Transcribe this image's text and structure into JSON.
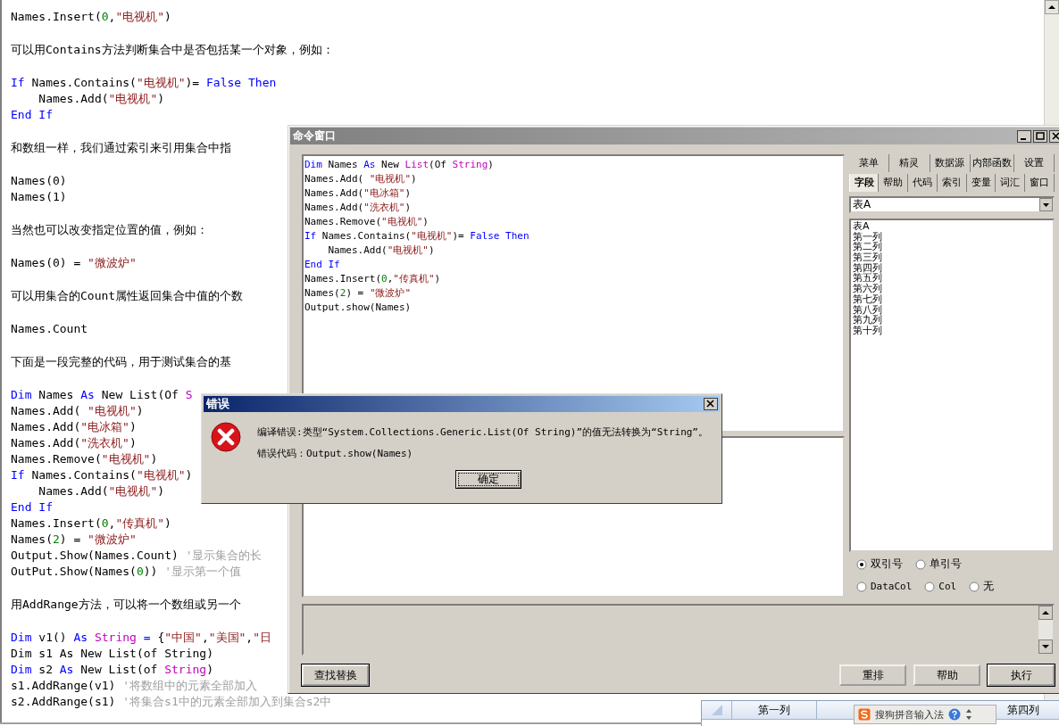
{
  "document": {
    "paragraphs": [
      {
        "lines": [
          [
            {
              "kind": "plain",
              "text": "Names.Insert("
            },
            {
              "kind": "number",
              "text": "0"
            },
            {
              "kind": "plain",
              "text": ","
            },
            {
              "kind": "string",
              "text": "\"电视机\""
            },
            {
              "kind": "plain",
              "text": ")"
            }
          ]
        ]
      },
      {
        "lines": [
          [
            {
              "kind": "prose",
              "text": "可以用Contains方法判断集合中是否包括某一个对象，例如："
            }
          ]
        ]
      },
      {
        "lines": [
          [
            {
              "kind": "keyword",
              "text": "If"
            },
            {
              "kind": "plain",
              "text": " Names.Contains("
            },
            {
              "kind": "string",
              "text": "\"电视机\""
            },
            {
              "kind": "plain",
              "text": ")= "
            },
            {
              "kind": "keyword",
              "text": "False Then"
            }
          ],
          [
            {
              "kind": "plain",
              "text": "    Names.Add("
            },
            {
              "kind": "string",
              "text": "\"电视机\""
            },
            {
              "kind": "plain",
              "text": ")"
            }
          ],
          [
            {
              "kind": "keyword",
              "text": "End If"
            }
          ]
        ]
      },
      {
        "lines": [
          [
            {
              "kind": "prose",
              "text": "和数组一样，我们通过索引来引用集合中指"
            }
          ]
        ]
      },
      {
        "lines": [
          [
            {
              "kind": "plain",
              "text": "Names(0)"
            }
          ],
          [
            {
              "kind": "plain",
              "text": "Names(1)"
            }
          ]
        ]
      },
      {
        "lines": [
          [
            {
              "kind": "prose",
              "text": "当然也可以改变指定位置的值，例如："
            }
          ]
        ]
      },
      {
        "lines": [
          [
            {
              "kind": "plain",
              "text": "Names(0) = "
            },
            {
              "kind": "string",
              "text": "\"微波炉\""
            }
          ]
        ]
      },
      {
        "lines": [
          [
            {
              "kind": "prose",
              "text": "可以用集合的Count属性返回集合中值的个数"
            }
          ]
        ]
      },
      {
        "lines": [
          [
            {
              "kind": "plain",
              "text": "Names.Count"
            }
          ]
        ]
      },
      {
        "lines": [
          [
            {
              "kind": "prose",
              "text": "下面是一段完整的代码，用于测试集合的基"
            }
          ]
        ]
      },
      {
        "lines": [
          [
            {
              "kind": "keyword",
              "text": "Dim"
            },
            {
              "kind": "plain",
              "text": " Names "
            },
            {
              "kind": "keyword",
              "text": "As"
            },
            {
              "kind": "plain",
              "text": " New List(Of "
            },
            {
              "kind": "type",
              "text": "S"
            }
          ],
          [
            {
              "kind": "plain",
              "text": "Names.Add( "
            },
            {
              "kind": "string",
              "text": "\"电视机\""
            },
            {
              "kind": "plain",
              "text": ")"
            }
          ],
          [
            {
              "kind": "plain",
              "text": "Names.Add("
            },
            {
              "kind": "string",
              "text": "\"电冰箱\""
            },
            {
              "kind": "plain",
              "text": ")"
            }
          ],
          [
            {
              "kind": "plain",
              "text": "Names.Add("
            },
            {
              "kind": "string",
              "text": "\"洗衣机\""
            },
            {
              "kind": "plain",
              "text": ")"
            }
          ],
          [
            {
              "kind": "plain",
              "text": "Names.Remove("
            },
            {
              "kind": "string",
              "text": "\"电视机\""
            },
            {
              "kind": "plain",
              "text": ")"
            }
          ],
          [
            {
              "kind": "keyword",
              "text": "If"
            },
            {
              "kind": "plain",
              "text": " Names.Contains("
            },
            {
              "kind": "string",
              "text": "\"电视机\""
            },
            {
              "kind": "plain",
              "text": ")"
            }
          ],
          [
            {
              "kind": "plain",
              "text": "    Names.Add("
            },
            {
              "kind": "string",
              "text": "\"电视机\""
            },
            {
              "kind": "plain",
              "text": ")"
            }
          ],
          [
            {
              "kind": "keyword",
              "text": "End If"
            }
          ],
          [
            {
              "kind": "plain",
              "text": "Names.Insert("
            },
            {
              "kind": "number",
              "text": "0"
            },
            {
              "kind": "plain",
              "text": ","
            },
            {
              "kind": "string",
              "text": "\"传真机\""
            },
            {
              "kind": "plain",
              "text": ")"
            }
          ],
          [
            {
              "kind": "plain",
              "text": "Names("
            },
            {
              "kind": "number",
              "text": "2"
            },
            {
              "kind": "plain",
              "text": ") = "
            },
            {
              "kind": "string",
              "text": "\"微波炉\""
            }
          ],
          [
            {
              "kind": "plain",
              "text": "Output.Show(Names.Count) "
            },
            {
              "kind": "comment",
              "text": "'显示集合的长"
            }
          ],
          [
            {
              "kind": "plain",
              "text": "OutPut.Show(Names("
            },
            {
              "kind": "number",
              "text": "0"
            },
            {
              "kind": "plain",
              "text": ")) "
            },
            {
              "kind": "comment",
              "text": "'显示第一个值"
            }
          ]
        ]
      },
      {
        "lines": [
          [
            {
              "kind": "prose",
              "text": "用AddRange方法，可以将一个数组或另一个"
            }
          ]
        ]
      },
      {
        "lines": [
          [
            {
              "kind": "keyword",
              "text": "Dim"
            },
            {
              "kind": "plain",
              "text": " v1() "
            },
            {
              "kind": "keyword",
              "text": "As"
            },
            {
              "kind": "type",
              "text": " String"
            },
            {
              "kind": "keyword",
              "text": " ="
            },
            {
              "kind": "plain",
              "text": " {"
            },
            {
              "kind": "string",
              "text": "\"中国\""
            },
            {
              "kind": "plain",
              "text": ","
            },
            {
              "kind": "string",
              "text": "\"美国\""
            },
            {
              "kind": "plain",
              "text": ","
            },
            {
              "kind": "string",
              "text": "\"日"
            }
          ],
          [
            {
              "kind": "plain",
              "text": "Dim s1 As New List(of String)"
            }
          ],
          [
            {
              "kind": "keyword",
              "text": "Dim"
            },
            {
              "kind": "plain",
              "text": " s2 "
            },
            {
              "kind": "keyword",
              "text": "As"
            },
            {
              "kind": "plain",
              "text": " New List(of "
            },
            {
              "kind": "type",
              "text": "String"
            },
            {
              "kind": "plain",
              "text": ")"
            }
          ],
          [
            {
              "kind": "plain",
              "text": "s1.AddRange(v1) "
            },
            {
              "kind": "comment",
              "text": "'将数组中的元素全部加入"
            }
          ],
          [
            {
              "kind": "plain",
              "text": "s2.AddRange(s1) "
            },
            {
              "kind": "comment",
              "text": "'将集合s1中的元素全部加入到集合s2中"
            }
          ]
        ]
      }
    ]
  },
  "command_window": {
    "title": "命令窗口",
    "code_lines": [
      [
        {
          "kind": "keyword",
          "text": "Dim"
        },
        {
          "kind": "plain",
          "text": " Names "
        },
        {
          "kind": "keyword",
          "text": "As"
        },
        {
          "kind": "plain",
          "text": " New "
        },
        {
          "kind": "type",
          "text": "List"
        },
        {
          "kind": "plain",
          "text": "(Of "
        },
        {
          "kind": "type",
          "text": "String"
        },
        {
          "kind": "plain",
          "text": ")"
        }
      ],
      [
        {
          "kind": "plain",
          "text": "Names.Add( "
        },
        {
          "kind": "string",
          "text": "\"电视机\""
        },
        {
          "kind": "plain",
          "text": ")"
        }
      ],
      [
        {
          "kind": "plain",
          "text": "Names.Add("
        },
        {
          "kind": "string",
          "text": "\"电冰箱\""
        },
        {
          "kind": "plain",
          "text": ")"
        }
      ],
      [
        {
          "kind": "plain",
          "text": "Names.Add("
        },
        {
          "kind": "string",
          "text": "\"洗衣机\""
        },
        {
          "kind": "plain",
          "text": ")"
        }
      ],
      [
        {
          "kind": "plain",
          "text": "Names.Remove("
        },
        {
          "kind": "string",
          "text": "\"电视机\""
        },
        {
          "kind": "plain",
          "text": ")"
        }
      ],
      [
        {
          "kind": "keyword",
          "text": "If"
        },
        {
          "kind": "plain",
          "text": " Names.Contains("
        },
        {
          "kind": "string",
          "text": "\"电视机\""
        },
        {
          "kind": "plain",
          "text": ")= "
        },
        {
          "kind": "keyword",
          "text": "False Then"
        }
      ],
      [
        {
          "kind": "plain",
          "text": "    Names.Add("
        },
        {
          "kind": "string",
          "text": "\"电视机\""
        },
        {
          "kind": "plain",
          "text": ")"
        }
      ],
      [
        {
          "kind": "keyword",
          "text": "End If"
        }
      ],
      [
        {
          "kind": "plain",
          "text": "Names.Insert("
        },
        {
          "kind": "number",
          "text": "0"
        },
        {
          "kind": "plain",
          "text": ","
        },
        {
          "kind": "string",
          "text": "\"传真机\""
        },
        {
          "kind": "plain",
          "text": ")"
        }
      ],
      [
        {
          "kind": "plain",
          "text": "Names("
        },
        {
          "kind": "number",
          "text": "2"
        },
        {
          "kind": "plain",
          "text": ") = "
        },
        {
          "kind": "string",
          "text": "\"微波炉\""
        }
      ],
      [
        {
          "kind": "plain",
          "text": "Output.show(Names)"
        }
      ]
    ],
    "tab_rows": [
      [
        {
          "label": "菜单",
          "selected": false
        },
        {
          "label": "精灵",
          "selected": false
        },
        {
          "label": "数据源",
          "selected": false
        },
        {
          "label": "内部函数",
          "selected": false
        },
        {
          "label": "设置",
          "selected": false
        }
      ],
      [
        {
          "label": "字段",
          "selected": true
        },
        {
          "label": "帮助",
          "selected": false
        },
        {
          "label": "代码",
          "selected": false
        },
        {
          "label": "索引",
          "selected": false
        },
        {
          "label": "变量",
          "selected": false
        },
        {
          "label": "词汇",
          "selected": false
        },
        {
          "label": "窗口",
          "selected": false
        }
      ]
    ],
    "table_select": {
      "value": "表A"
    },
    "field_list": [
      "表A",
      "第一列",
      "第二列",
      "第三列",
      "第四列",
      "第五列",
      "第六列",
      "第七列",
      "第八列",
      "第九列",
      "第十列"
    ],
    "quote_options": [
      [
        {
          "label": "双引号",
          "selected": true
        },
        {
          "label": "单引号",
          "selected": false
        }
      ],
      [
        {
          "label": "DataCol",
          "selected": false
        },
        {
          "label": "Col",
          "selected": false
        },
        {
          "label": "无",
          "selected": false
        }
      ]
    ],
    "left_buttons": [
      "查找替换"
    ],
    "right_buttons": [
      "重排",
      "帮助",
      "执行"
    ]
  },
  "error_dialog": {
    "title": "错误",
    "message": "编译错误:类型“System.Collections.Generic.List(Of String)”的值无法转换为“String”。",
    "error_code": "错误代码：Output.show(Names)",
    "button": "确定"
  },
  "sheet": {
    "columns": [
      {
        "label": "第一列"
      },
      {
        "label": "第四列"
      }
    ]
  },
  "input_method": {
    "label": "搜狗拼音输入法"
  }
}
